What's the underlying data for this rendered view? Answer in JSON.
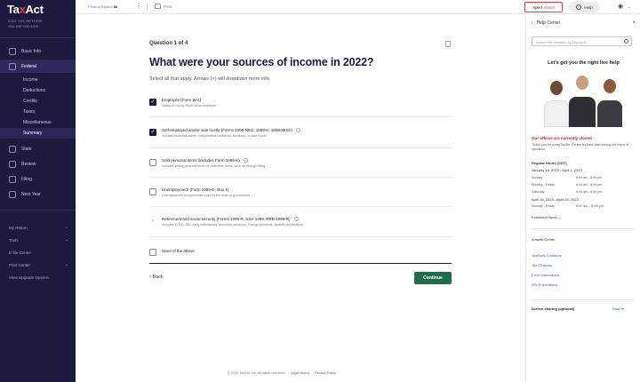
{
  "brand": {
    "name_part1": "Ta",
    "name_accent": "x",
    "name_part2": "Act"
  },
  "product": {
    "line1": "2022 TAX RETURN",
    "line2": "ONLINE DELUXE"
  },
  "sidebar": {
    "main_items": [
      {
        "label": "Basic Info",
        "icon": "person-icon"
      },
      {
        "label": "Federal",
        "icon": "bank-icon"
      }
    ],
    "sub_items": [
      "Income",
      "Deductions",
      "Credits",
      "Taxes",
      "Miscellaneous",
      "Summary"
    ],
    "after_items": [
      {
        "label": "State",
        "icon": "map-icon"
      },
      {
        "label": "Review",
        "icon": "checklist-icon"
      },
      {
        "label": "Filing",
        "icon": "send-icon"
      },
      {
        "label": "Next Year",
        "icon": "calendar-icon"
      }
    ],
    "lower_items": [
      {
        "label": "My Return"
      },
      {
        "label": "Tools"
      },
      {
        "label": "E-file Center"
      },
      {
        "label": "Print Center"
      },
      {
        "label": "View Upgrade Options"
      }
    ]
  },
  "topbar": {
    "refund_label": "Federal Refund",
    "refund_value": "$0",
    "print_label": "Print",
    "xpert_label": "Xpert",
    "xpert_accent": "Assist",
    "help_label": "Help"
  },
  "question": {
    "counter": "Question 1 of 4",
    "title": "What were your sources of income in 2022?",
    "subtitle": "Select all that apply. Arrows (>) will dropdown more info.",
    "options": [
      {
        "title": "Employee (Form W-2)",
        "desc": "Salary or hourly. Work for an employer",
        "checked": true
      },
      {
        "title": "Self-employed and/or side hustle (Forms 1099-NEC, 1099-K, 1099-MISC)",
        "desc": "Includes business owner, independent contractor, freelance, or side hustle",
        "checked": true
      },
      {
        "title": "Sold personal items (includes Form 1099-K)",
        "desc": "Includes selling personal items or collectible items, such as through eBay",
        "checked": false
      },
      {
        "title": "Unemployment (Form 1099-G, Box 1)",
        "desc": "Unemployment compensation paid by the state or government",
        "checked": false
      },
      {
        "title": "Retirement and social security (Forms 1099-R, SSA-1099, RRB-1099-R)",
        "desc": "Includes 401(k), IRA, early withdrawals, annuities, pensions, Foreign pensions, disaster distributions",
        "checked": false
      },
      {
        "title": "None of the above",
        "desc": "",
        "checked": false
      }
    ],
    "back_label": "Back",
    "continue_label": "Continue"
  },
  "footer": {
    "copyright": "© 2022 TaxAct, Inc. All rights reserved.",
    "link1": "Legal Notice",
    "link2": "Privacy Policy"
  },
  "help_center": {
    "title": "Help Center",
    "search_placeholder": "Search for answers by keyword",
    "hero_title": "Let's get you the right live help",
    "closed_text": "Our offices are currently closed",
    "thanks_text": "Thank you for using TaxAct. Please try back later during our hours of operation.",
    "regular_hours_label": "Regular Hours (CDT)",
    "regular_range": "January 18, 2023 - April 3, 2023",
    "regular_rows": [
      {
        "day": "Sunday",
        "hours": "8:00 am - 8:00 pm"
      },
      {
        "day": "Monday - Friday",
        "hours": "8:00 am - 8:00 pm"
      },
      {
        "day": "Saturday",
        "hours": "8:00 am - 8:00 pm"
      }
    ],
    "april_range": "April 18, 2023 - April 18, 2023",
    "april_rows": [
      {
        "day": "Monday - Friday",
        "hours": "8:00 am - 10:00 pm"
      }
    ],
    "extended_label": "Extended Hours",
    "answer_center": "Answer Center",
    "links": [
      "TaxTools Guidance",
      "Tax Glossary",
      "Form Instructions",
      "IRS Publications"
    ],
    "screen_share_label": "Screen sharing (optional)",
    "start_label": "Start"
  },
  "colors": {
    "sidebar": "#1d1a3f",
    "accent": "#e8394a",
    "continue": "#1f6e4b"
  }
}
